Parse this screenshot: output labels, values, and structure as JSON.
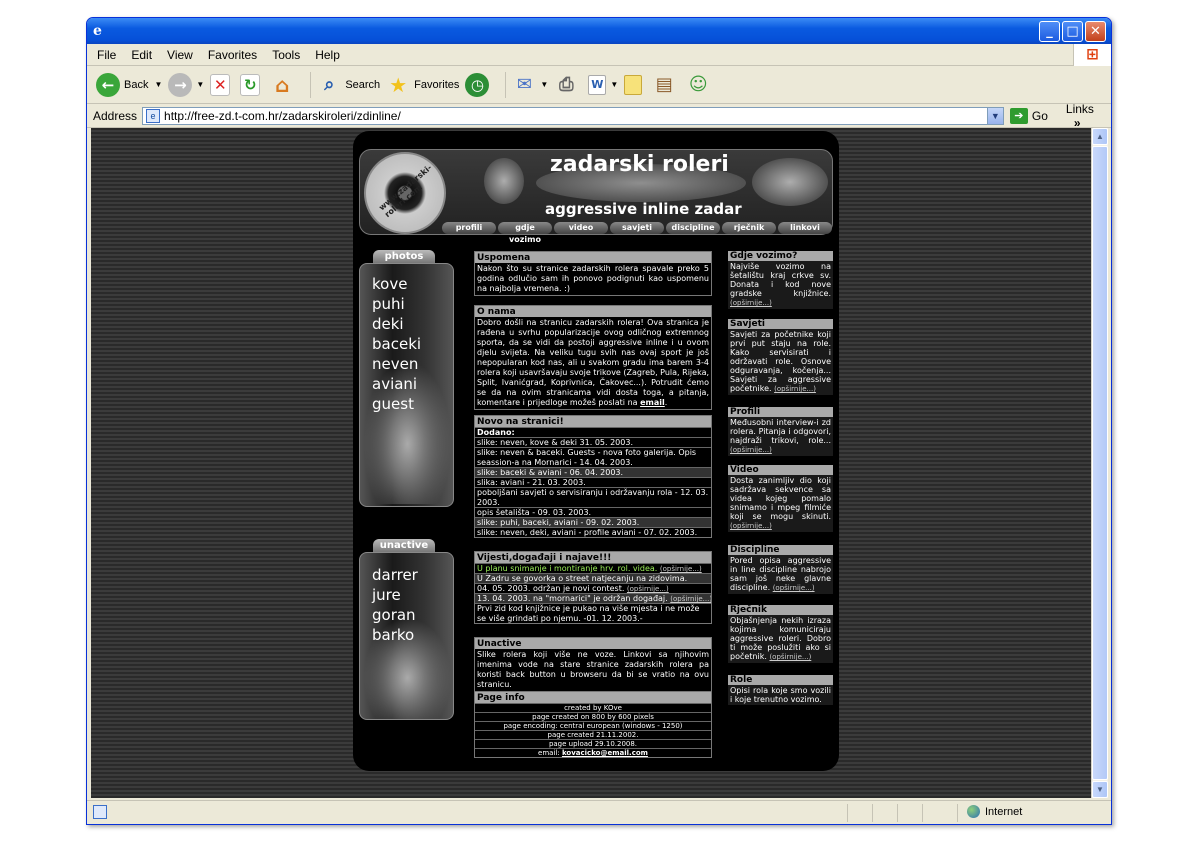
{
  "window": {
    "icon": "ie-icon",
    "min": "_",
    "max": "□",
    "close": "✕"
  },
  "menu": [
    "File",
    "Edit",
    "View",
    "Favorites",
    "Tools",
    "Help"
  ],
  "toolbar": {
    "back": "Back",
    "search": "Search",
    "favorites": "Favorites"
  },
  "address": {
    "label": "Address",
    "url": "http://free-zd.t-com.hr/zadarskiroleri/zdinline/",
    "go": "Go",
    "links": "Links"
  },
  "status": {
    "zone": "Internet"
  },
  "site": {
    "logo_text": "www.zadarski-roleri.com",
    "name": "zadarski roleri",
    "tagline": "aggressive inline zadar",
    "nav": [
      "profili",
      "gdje vozimo",
      "video",
      "savjeti",
      "discipline",
      "rječnik",
      "linkovi"
    ],
    "photos": {
      "title": "photos",
      "items": [
        "kove",
        "puhi",
        "deki",
        "baceki",
        "neven",
        "aviani",
        "guest"
      ]
    },
    "unactive": {
      "title": "unactive",
      "items": [
        "darrer",
        "jure",
        "goran",
        "barko"
      ]
    },
    "uspomena": {
      "title": "Uspomena",
      "text": "Nakon što su stranice zadarskih rolera spavale preko 5 godina odlučio sam ih ponovo podignuti kao uspomenu na najbolja vremena. :)"
    },
    "onama": {
      "title": "O nama",
      "text": "Dobro došli na stranicu zadarskih rolera! Ova stranica je rađena u svrhu popularizacije ovog odličnog extremnog sporta, da se vidi da postoji aggressive inline i u ovom djelu svijeta. Na veliku tugu svih nas ovaj sport je još nepopularan kod nas, ali u svakom gradu ima barem 3-4 rolera koji usavršavaju svoje trikove (Zagreb, Pula, Rijeka, Split, Ivanićgrad, Koprivnica, Čakovec...). Potrudit ćemo se da na ovim stranicama vidi dosta toga, a pitanja, komentare i prijedloge možeš poslati na ",
      "link": "email",
      "end": "."
    },
    "novo": {
      "title": "Novo na stranici!",
      "sub": "Dodano:",
      "rows": [
        "slike: neven, kove & deki 31. 05. 2003.",
        "slike: neven & baceki. Guests - nova foto galerija. Opis seassion-a na Mornarici - 14. 04. 2003.",
        "slike: baceki & aviani - 06. 04. 2003.",
        "slika: aviani - 21. 03. 2003.",
        "poboljšani savjeti o servisiranju i održavanju rola - 12. 03. 2003.",
        "opis šetališta - 09. 03. 2003.",
        "slike: puhi, baceki, aviani - 09. 02. 2003.",
        "slike: neven, deki, aviani - profile aviani - 07. 02. 2003."
      ]
    },
    "vijesti": {
      "title": "Vijesti,događaji i najave!!!",
      "r1": "U planu snimanje i montiranje hrv. rol. videa.",
      "r2": "U Zadru se govorka o street natjecanju na zidovima.",
      "r3": "04. 05. 2003. održan je novi contest.",
      "r4": "13. 04. 2003. na \"mornarici\" je održan događaj.",
      "r5": "Prvi zid kod knjižnice je pukao na više mjesta i ne može se više grindati po njemu. -01. 12. 2003.-",
      "more": "(opširnije...)"
    },
    "unactive_box": {
      "title": "Unactive",
      "text": "Slike rolera koji više ne voze. Linkovi sa njihovim imenima vode na stare stranice zadarskih rolera pa koristi back button u browseru da bi se vratio na ovu stranicu."
    },
    "pageinfo": {
      "title": "Page info",
      "rows": [
        "created by KOve",
        "page created on 800 by 600 pixels",
        "page encoding: central european (windows - 1250)",
        "page created 21.11.2002.",
        "page upload 29.10.2008."
      ],
      "email_label": "email: ",
      "email": "kovacicko@email.com"
    },
    "right": [
      {
        "title": "Gdje vozimo?",
        "text": "Najviše vozimo na šetalištu kraj crkve sv. Donata i kod nove gradske knjižnice."
      },
      {
        "title": "Savjeti",
        "text": "Savjeti za početnike koji prvi put staju na role. Kako servisirati i održavati role. Osnove odguravanja, kočenja... Savjeti za aggressive početnike."
      },
      {
        "title": "Profili",
        "text": "Međusobni interview-i zd rolera. Pitanja i odgovori, najdraži trikovi, role..."
      },
      {
        "title": "Video",
        "text": "Dosta zanimljiv dio koji sadržava sekvence sa videa kojeg pomalo snimamo i mpeg filmiće koji se mogu skinuti."
      },
      {
        "title": "Discipline",
        "text": "Pored opisa aggressive in line discipline nabrojo sam još neke glavne discipline."
      },
      {
        "title": "Rječnik",
        "text": "Objašnjenja nekih izraza kojima komuniciraju aggressive roleri. Dobro ti može poslužiti ako si početnik."
      },
      {
        "title": "Role",
        "text": "Opisi rola koje smo vozili i koje trenutno vozimo."
      }
    ],
    "more": "(opširnije...)"
  }
}
